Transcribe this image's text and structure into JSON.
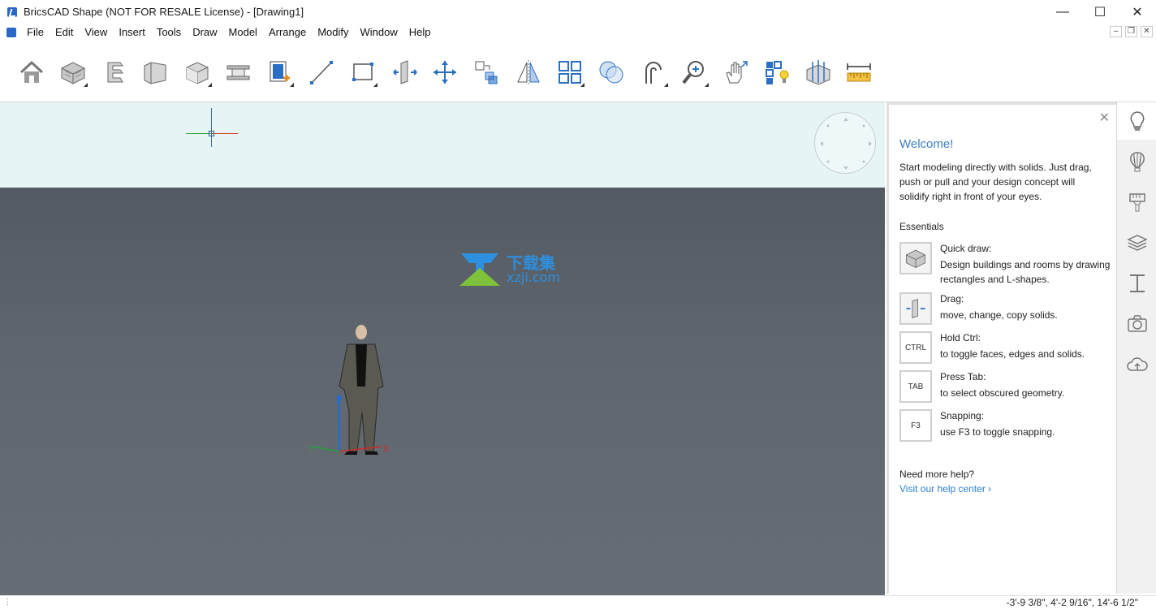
{
  "window": {
    "title": "BricsCAD Shape (NOT FOR RESALE License) - [Drawing1]",
    "controls": {
      "minimize": "—",
      "maximize": "☐",
      "close": "✕"
    }
  },
  "menu": {
    "items": [
      "File",
      "Edit",
      "View",
      "Insert",
      "Tools",
      "Draw",
      "Model",
      "Arrange",
      "Modify",
      "Window",
      "Help"
    ],
    "mdi": {
      "minimize": "–",
      "restore": "❐",
      "close": "✕"
    }
  },
  "toolbar": {
    "tools": [
      "home-icon",
      "quick-draw-icon",
      "polysolid-icon",
      "slab-icon",
      "box-icon",
      "beam-icon",
      "window-insert-icon",
      "line-icon",
      "rectangle-icon",
      "push-pull-icon",
      "move-icon",
      "copy-icon",
      "mirror-icon",
      "array-icon",
      "boolean-icon",
      "fillet-icon",
      "zoom-icon",
      "pan-icon",
      "properties-icon",
      "section-icon",
      "measure-icon"
    ],
    "accent": "#2a6fc3"
  },
  "viewport": {
    "sky_color": "#e6f4f5",
    "ground_color": "#5f666e",
    "watermark_line1": "下载集",
    "watermark_line2": "xzji.com",
    "axis_x": "X",
    "axis_y": "Y",
    "axis_z": "Z"
  },
  "panel": {
    "title": "Welcome!",
    "intro": "Start modeling directly with solids. Just drag, push or pull and your design concept will solidify right in front of your eyes.",
    "section": "Essentials",
    "essentials": [
      {
        "icon": "quick-draw-icon",
        "key": "",
        "title": "Quick draw:",
        "desc": "Design buildings and rooms by drawing rectangles and L-shapes."
      },
      {
        "icon": "drag-icon",
        "key": "",
        "title": "Drag:",
        "desc": "move, change, copy solids."
      },
      {
        "icon": "key",
        "key": "CTRL",
        "title": "Hold Ctrl:",
        "desc": "to toggle faces, edges and solids."
      },
      {
        "icon": "key",
        "key": "TAB",
        "title": "Press Tab:",
        "desc": "to select obscured geometry."
      },
      {
        "icon": "key",
        "key": "F3",
        "title": "Snapping:",
        "desc": "use F3 to toggle snapping."
      }
    ],
    "help_title": "Need more help?",
    "help_link": "Visit our help center ›",
    "link_color": "#2c7fcf"
  },
  "strip": {
    "items": [
      "lightbulb-icon",
      "balloon-icon",
      "brush-icon",
      "layers-icon",
      "i-beam-icon",
      "camera-icon",
      "cloud-upload-icon"
    ]
  },
  "status": {
    "coords": "-3'-9 3/8\", 4'-2 9/16\", 14'-6 1/2\""
  }
}
